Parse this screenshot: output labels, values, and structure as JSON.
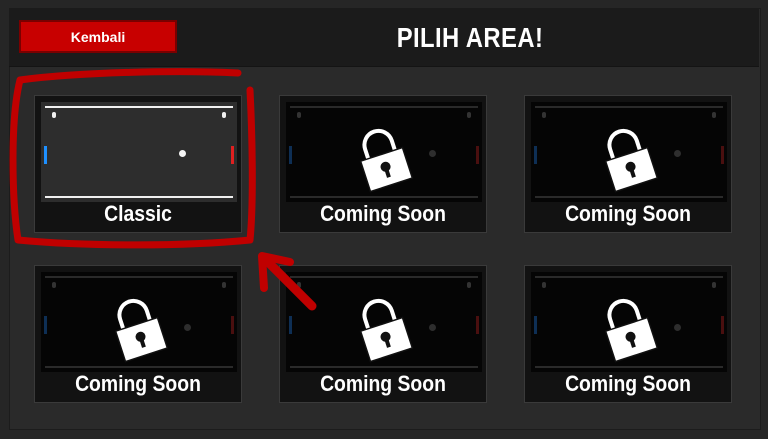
{
  "header": {
    "back_label": "Kembali",
    "title": "PILIH AREA!"
  },
  "areas": [
    {
      "label": "Classic",
      "locked": false
    },
    {
      "label": "Coming Soon",
      "locked": true
    },
    {
      "label": "Coming Soon",
      "locked": true
    },
    {
      "label": "Coming Soon",
      "locked": true
    },
    {
      "label": "Coming Soon",
      "locked": true
    },
    {
      "label": "Coming Soon",
      "locked": true
    }
  ],
  "colors": {
    "accent": "#c80000",
    "highlight": "#c00000",
    "background": "#262626"
  },
  "icons": {
    "lock": "padlock-icon",
    "annotation": "red-circle-arrow"
  }
}
